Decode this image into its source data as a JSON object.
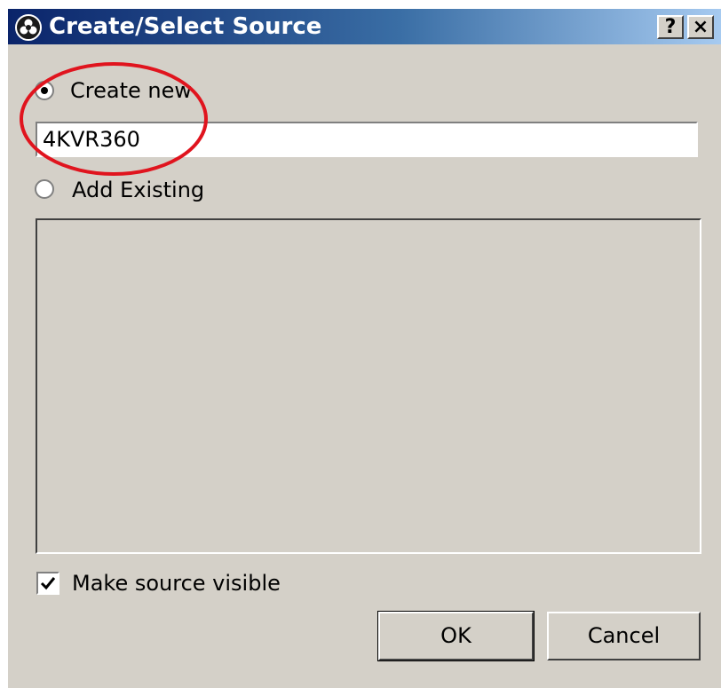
{
  "window": {
    "title": "Create/Select Source",
    "icon": "obs-logo-icon",
    "help_label": "?",
    "close_label": "×"
  },
  "create_new": {
    "label": "Create new",
    "selected": true,
    "value": "4KVR360"
  },
  "add_existing": {
    "label": "Add Existing",
    "selected": false,
    "items": []
  },
  "make_visible": {
    "label": "Make source visible",
    "checked": true
  },
  "buttons": {
    "ok_label": "OK",
    "cancel_label": "Cancel"
  },
  "colors": {
    "dialog_bg": "#d4d0c8",
    "titlebar_start": "#0a246a",
    "titlebar_end": "#a6caf0",
    "annotation_circle": "#e0141e"
  }
}
